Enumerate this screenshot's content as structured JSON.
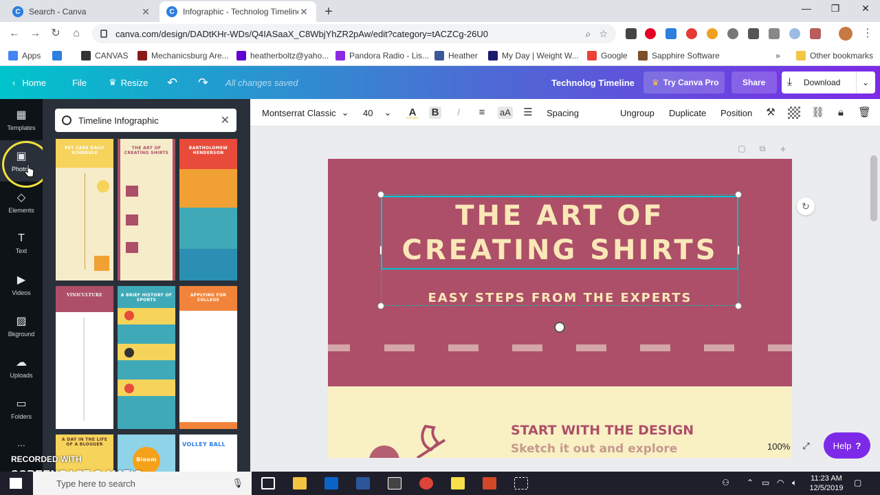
{
  "browser": {
    "tabs": [
      {
        "title": "Search - Canva",
        "favicon": "C"
      },
      {
        "title": "Infographic - Technolog Timeline",
        "favicon": "C"
      }
    ],
    "url": "canva.com/design/DADtKHr-WDs/Q4IASaaX_C8WbjYhZR2pAw/edit?category=tACZCg-26U0",
    "bookmarks": [
      {
        "label": "Apps",
        "color": "#4285f4"
      },
      {
        "label": "",
        "color": "#2d7fe0"
      },
      {
        "label": "CANVAS",
        "color": "#333333"
      },
      {
        "label": "Mechanicsburg Are...",
        "color": "#8b1a1a"
      },
      {
        "label": "heatherboltz@yaho...",
        "color": "#6001d2"
      },
      {
        "label": "Pandora Radio - Lis...",
        "color": "#8a2be2"
      },
      {
        "label": "Heather",
        "color": "#3b5998"
      },
      {
        "label": "My Day | Weight W...",
        "color": "#1a1a6e"
      },
      {
        "label": "Google",
        "color": "#ea4335"
      },
      {
        "label": "Sapphire Software",
        "color": "#7a4f2a"
      }
    ],
    "other_bookmarks": "Other bookmarks"
  },
  "header": {
    "home": "Home",
    "file": "File",
    "resize": "Resize",
    "saved_status": "All changes saved",
    "design_name": "Technolog Timeline",
    "try_pro": "Try Canva Pro",
    "share": "Share",
    "download": "Download"
  },
  "rail": [
    {
      "label": "Templates",
      "icon": "▦"
    },
    {
      "label": "Photos",
      "icon": "▣"
    },
    {
      "label": "Elements",
      "icon": "◇"
    },
    {
      "label": "Text",
      "icon": "T"
    },
    {
      "label": "Videos",
      "icon": "▶"
    },
    {
      "label": "Bkground",
      "icon": "▨"
    },
    {
      "label": "Uploads",
      "icon": "☁"
    },
    {
      "label": "Folders",
      "icon": "▭"
    },
    {
      "label": "...",
      "icon": ""
    }
  ],
  "search": {
    "value": "Timeline Infographic"
  },
  "templates": [
    {
      "title": "PET CARE DAILY SCHEDULE",
      "bg": "#f6d35b",
      "fg": "#ffffff"
    },
    {
      "title": "THE ART OF CREATING SHIRTS",
      "bg": "#f6ecc9",
      "fg": "#ad4f68"
    },
    {
      "title": "BARTHOLOMEW HENDERSON",
      "bg": "#f1a133",
      "fg": "#ffffff"
    },
    {
      "title": "VINICULTURE",
      "bg": "#ffffff",
      "fg": "#ffffff"
    },
    {
      "title": "A BRIEF HISTORY OF SPORTS",
      "bg": "#3fa9b8",
      "fg": "#ffffff"
    },
    {
      "title": "APPLYING FOR COLLEGE",
      "bg": "#ffffff",
      "fg": "#ffffff"
    },
    {
      "title": "A DAY IN THE LIFE OF A BLOGGER",
      "bg": "#f6d35b",
      "fg": "#5a3b2a"
    },
    {
      "title": "Bloom",
      "bg": "#8fd3e8",
      "fg": "#ffffff"
    },
    {
      "title": "VOLLEY BALL",
      "bg": "#ffffff",
      "fg": "#2d7fe0"
    }
  ],
  "toolbar": {
    "font": "Montserrat Classic",
    "size": "40",
    "spacing": "Spacing",
    "ungroup": "Ungroup",
    "duplicate": "Duplicate",
    "position": "Position",
    "case_toggle": "aA"
  },
  "design": {
    "title_line1": "THE ART OF",
    "title_line2": "CREATING SHIRTS",
    "subtitle": "EASY STEPS FROM THE EXPERTS",
    "step_title": "START WITH THE DESIGN",
    "step_subtitle": "Sketch it out and explore"
  },
  "zoom": "100%",
  "help": "Help",
  "watermark": {
    "line1": "RECORDED WITH",
    "line2": "SCREENCAST-O-MATIC"
  },
  "taskbar": {
    "search_placeholder": "Type here to search",
    "time": "11:23 AM",
    "date": "12/5/2019"
  },
  "colors": {
    "design_top": "#ad4f68",
    "design_bottom": "#f9f0c4",
    "accent": "#7d2ae8"
  }
}
